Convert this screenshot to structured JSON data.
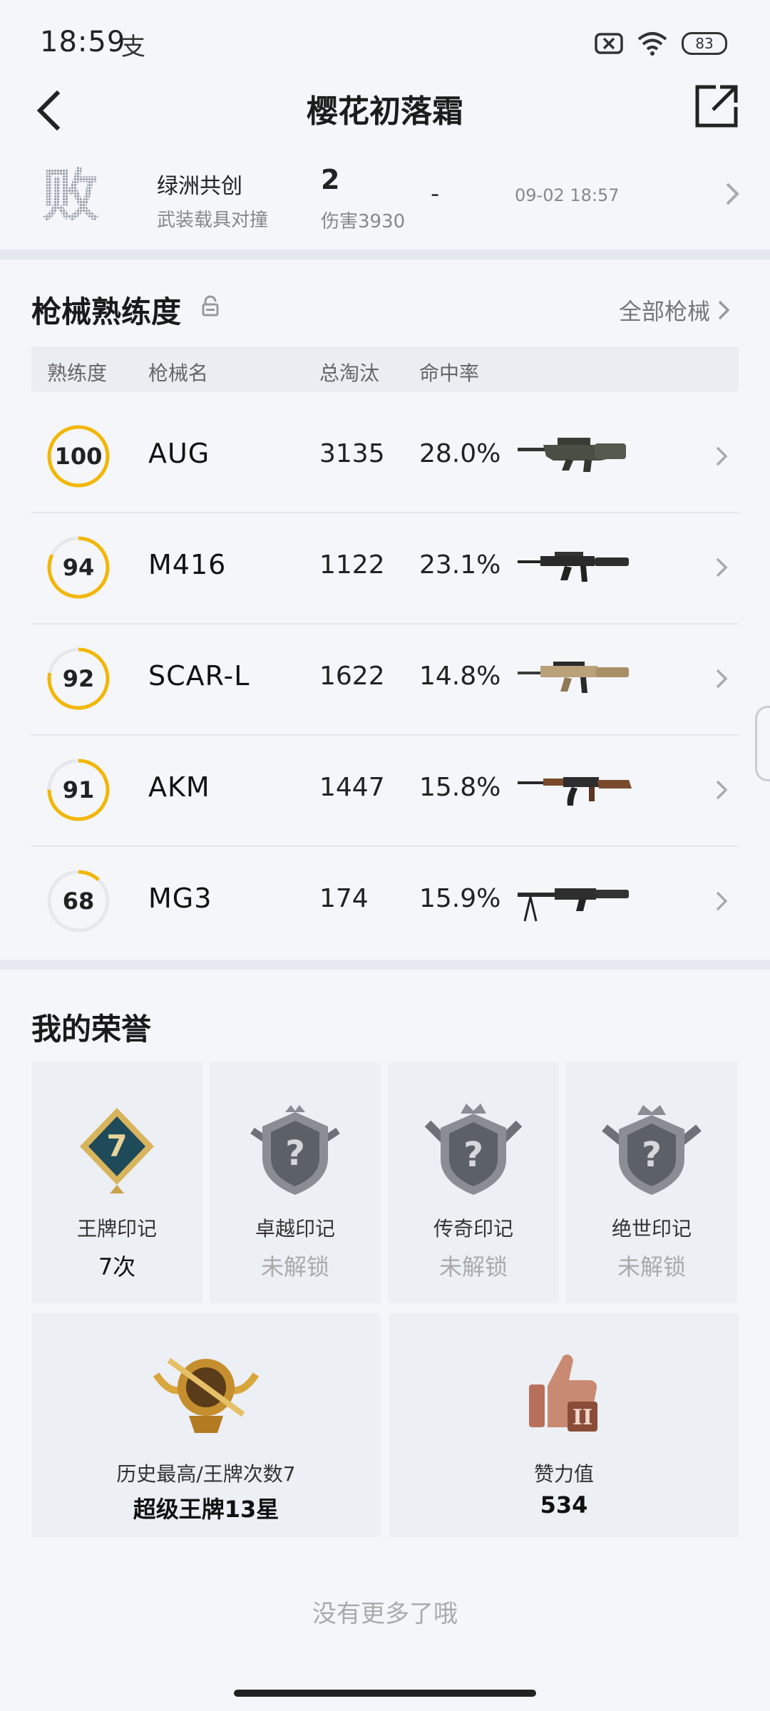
{
  "status": {
    "time": "18:59",
    "extra": "支",
    "battery": "83"
  },
  "header": {
    "title": "樱花初落霜",
    "back_icon": "chevron-left-icon",
    "share_icon": "share-external-icon"
  },
  "match": {
    "result": "败",
    "mode": "绿洲共创",
    "sub": "武装载具对撞",
    "rank": "2",
    "damage": "伤害3930",
    "dash": "-",
    "time": "09-02 18:57"
  },
  "weapons": {
    "title": "枪械熟练度",
    "all_label": "全部枪械",
    "columns": [
      "熟练度",
      "枪械名",
      "总淘汰",
      "命中率"
    ],
    "rows": [
      {
        "level": "100",
        "progress": 1.0,
        "name": "AUG",
        "kills": "3135",
        "rate": "28.0%"
      },
      {
        "level": "94",
        "progress": 0.82,
        "name": "M416",
        "kills": "1122",
        "rate": "23.1%"
      },
      {
        "level": "92",
        "progress": 0.78,
        "name": "SCAR-L",
        "kills": "1622",
        "rate": "14.8%"
      },
      {
        "level": "91",
        "progress": 0.75,
        "name": "AKM",
        "kills": "1447",
        "rate": "15.8%"
      },
      {
        "level": "68",
        "progress": 0.12,
        "name": "MG3",
        "kills": "174",
        "rate": "15.9%"
      }
    ]
  },
  "honors": {
    "title": "我的荣誉",
    "badges": [
      {
        "label": "王牌印记",
        "value": "7次",
        "locked": false,
        "badge_text": "7"
      },
      {
        "label": "卓越印记",
        "value": "未解锁",
        "locked": true,
        "badge_text": "?"
      },
      {
        "label": "传奇印记",
        "value": "未解锁",
        "locked": true,
        "badge_text": "?"
      },
      {
        "label": "绝世印记",
        "value": "未解锁",
        "locked": true,
        "badge_text": "?"
      }
    ],
    "highest": {
      "label": "历史最高/王牌次数7",
      "value": "超级王牌13星"
    },
    "likes": {
      "label": "赞力值",
      "value": "534",
      "badge_text": "II"
    }
  },
  "footer": {
    "note": "没有更多了哦"
  },
  "colors": {
    "accent": "#f2b705",
    "background": "#f4f6fa",
    "card": "#eceff4"
  }
}
